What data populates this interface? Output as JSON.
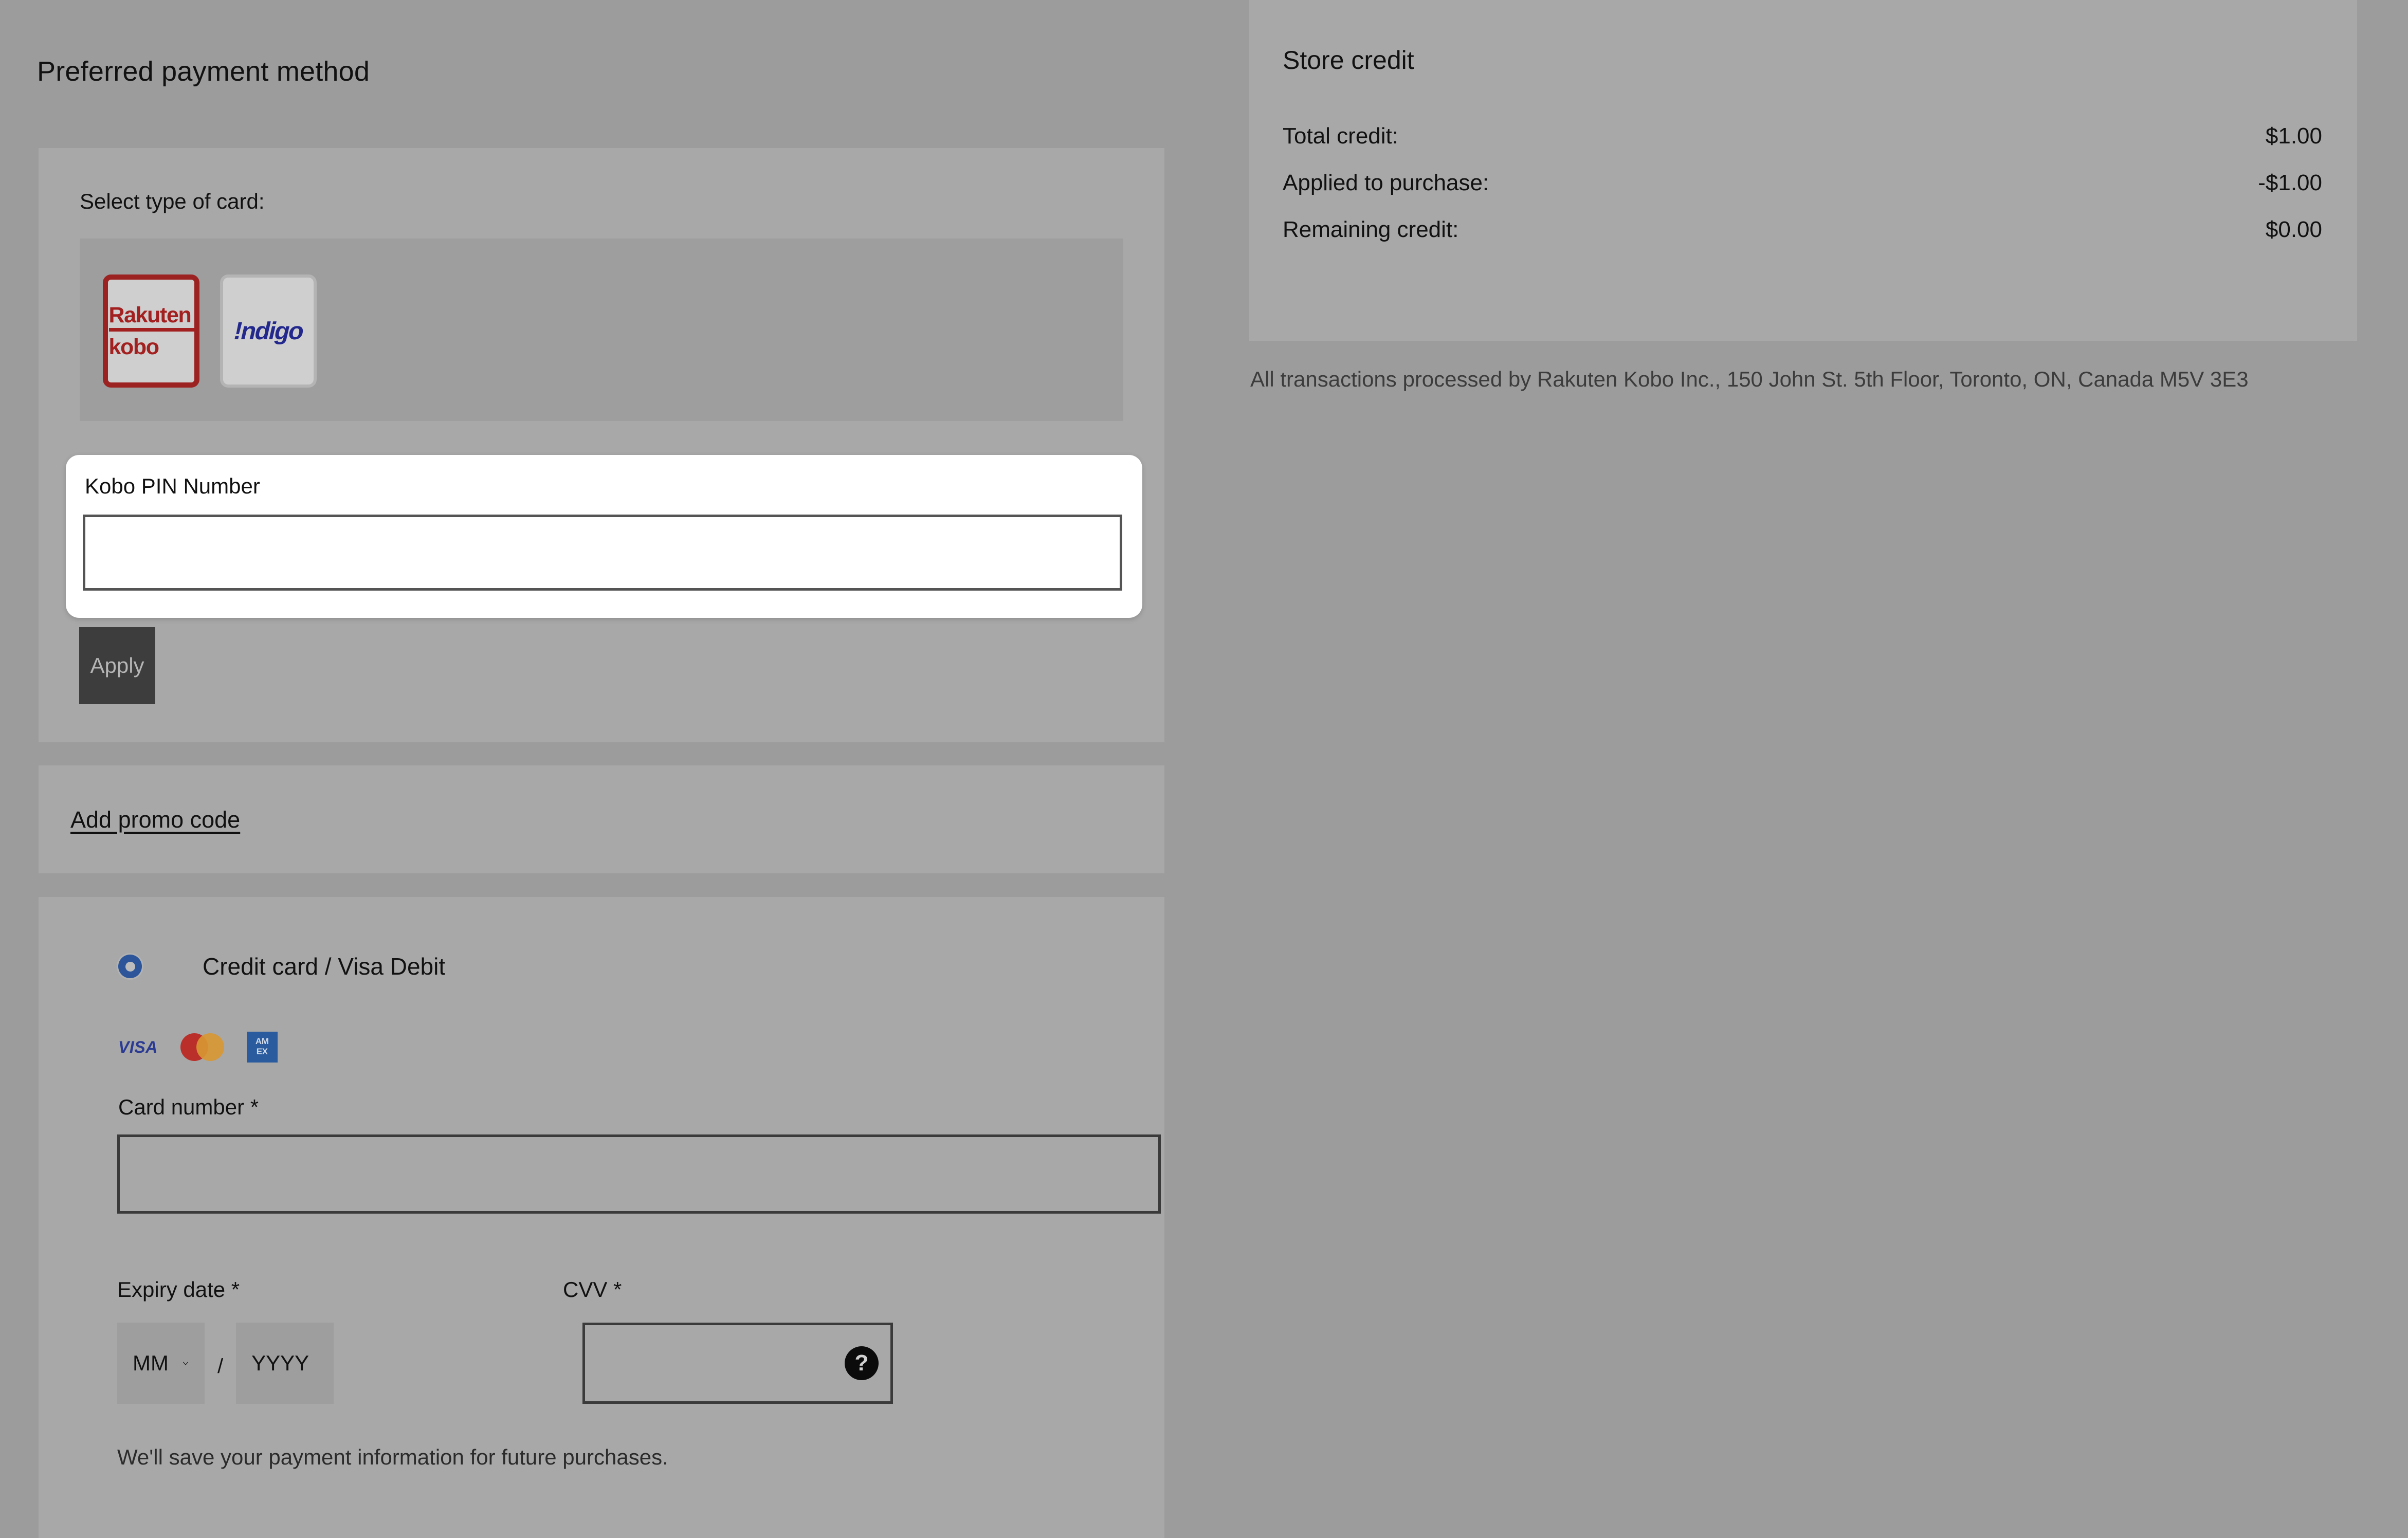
{
  "payment": {
    "title": "Preferred payment method",
    "card_type": {
      "label": "Select type of card:",
      "options": [
        {
          "name": "rakuten-kobo",
          "line1": "Rakuten",
          "line2": "kobo",
          "selected": true
        },
        {
          "name": "indigo",
          "label": "!ndigo",
          "selected": false
        }
      ]
    },
    "pin": {
      "label": "Kobo PIN Number",
      "value": "",
      "placeholder": ""
    },
    "apply_label": "Apply",
    "promo_label": "Add promo code",
    "credit_card": {
      "radio_label": "Credit card / Visa Debit",
      "radio_selected": true,
      "brands": [
        "VISA",
        "mastercard",
        "AMEX"
      ],
      "amex_line1": "AM",
      "amex_line2": "EX",
      "visa_text": "VISA",
      "card_number_label": "Card number *",
      "card_number_value": "",
      "expiry_label": "Expiry date *",
      "expiry_month": "MM",
      "expiry_year": "YYYY",
      "expiry_separator": "/",
      "cvv_label": "CVV *",
      "cvv_value": "",
      "cvv_help_glyph": "?",
      "save_note": "We'll save your payment information for future purchases."
    }
  },
  "store_credit": {
    "title": "Store credit",
    "rows": [
      {
        "label": "Total credit:",
        "value": "$1.00"
      },
      {
        "label": "Applied to purchase:",
        "value": "-$1.00"
      },
      {
        "label": "Remaining credit:",
        "value": "$0.00"
      }
    ],
    "legal": "All transactions processed by Rakuten Kobo Inc., 150 John St. 5th Floor, Toronto, ON, Canada M5V 3E3"
  },
  "colors": {
    "page_bg": "#9c9c9c",
    "panel_bg": "#a8a8a8",
    "inner_bg": "#9e9e9e",
    "kobo_red": "#a32020",
    "indigo_blue": "#23288c",
    "radio_blue": "#2c5699",
    "apply_bg": "#3d3d3d",
    "amex_blue": "#2a5b9e"
  }
}
